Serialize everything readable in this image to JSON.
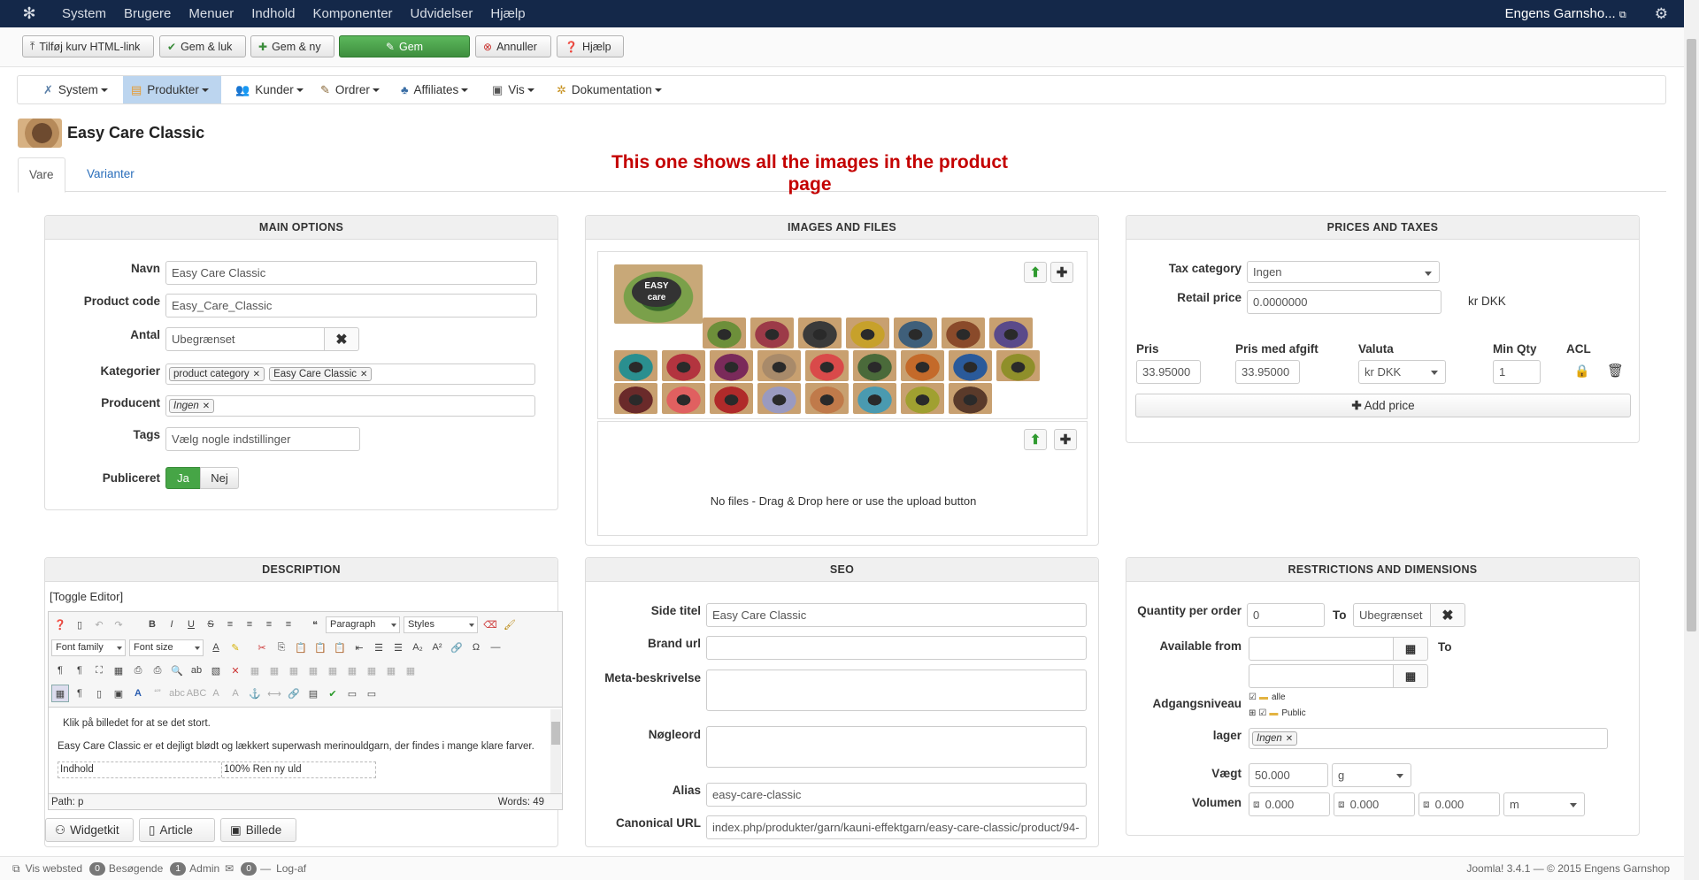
{
  "topnav": {
    "items": [
      "System",
      "Brugere",
      "Menuer",
      "Indhold",
      "Komponenter",
      "Udvidelser",
      "Hjælp"
    ],
    "site_name": "Engens Garnsho..."
  },
  "toolbar": {
    "add_cart_link": "Tilføj kurv HTML-link",
    "save_close": "Gem & luk",
    "save_new": "Gem & ny",
    "save": "Gem",
    "cancel": "Annuller",
    "help": "Hjælp"
  },
  "subnav": {
    "items": [
      "System",
      "Produkter",
      "Kunder",
      "Ordrer",
      "Affiliates",
      "Vis",
      "Dokumentation"
    ]
  },
  "product": {
    "title": "Easy Care Classic"
  },
  "tabs": {
    "item": "Vare",
    "variants": "Varianter"
  },
  "annotation": "This one shows all the images in the product page",
  "main_options": {
    "heading": "MAIN OPTIONS",
    "name_label": "Navn",
    "name_value": "Easy Care Classic",
    "code_label": "Product code",
    "code_value": "Easy_Care_Classic",
    "qty_label": "Antal",
    "qty_value": "Ubegrænset",
    "cat_label": "Kategorier",
    "cat_chip1": "product category",
    "cat_chip2": "Easy Care Classic",
    "prod_label": "Producent",
    "prod_chip": "Ingen",
    "tags_label": "Tags",
    "tags_placeholder": "Vælg nogle indstillinger",
    "pub_label": "Publiceret",
    "pub_yes": "Ja",
    "pub_no": "Nej"
  },
  "images": {
    "heading": "IMAGES AND FILES",
    "no_files": "No files - Drag & Drop here or use the upload button",
    "thumb_badge_line1": "EASY",
    "thumb_badge_line2": "care"
  },
  "prices": {
    "heading": "PRICES AND TAXES",
    "tax_label": "Tax category",
    "tax_value": "Ingen",
    "retail_label": "Retail price",
    "retail_value": "0.0000000",
    "retail_currency": "kr DKK",
    "col_price": "Pris",
    "col_price_tax": "Pris med afgift",
    "col_currency": "Valuta",
    "col_minqty": "Min Qty",
    "col_acl": "ACL",
    "price_value": "33.95000",
    "price_tax_value": "33.95000",
    "currency_value": "kr DKK",
    "minqty_value": "1",
    "add_price": "Add price"
  },
  "description": {
    "heading": "DESCRIPTION",
    "toggle": "[Toggle Editor]",
    "paragraph_sel": "Paragraph",
    "styles_sel": "Styles",
    "font_family_sel": "Font family",
    "font_size_sel": "Font size",
    "line1": "Klik på billedet for at se det stort.",
    "line2": "Easy Care Classic er et dejligt blødt og lækkert superwash merinouldgarn, der findes i mange klare farver.",
    "table_c1": "Indhold",
    "table_c2": "100% Ren ny uld",
    "path": "Path: p",
    "words": "Words: 49",
    "btn_widgetkit": "Widgetkit",
    "btn_article": "Article",
    "btn_image": "Billede"
  },
  "seo": {
    "heading": "SEO",
    "page_title_label": "Side titel",
    "page_title_value": "Easy Care Classic",
    "brand_url_label": "Brand url",
    "meta_label": "Meta-beskrivelse",
    "keywords_label": "Nøgleord",
    "alias_label": "Alias",
    "alias_value": "easy-care-classic",
    "canonical_label": "Canonical URL",
    "canonical_value": "index.php/produkter/garn/kauni-effektgarn/easy-care-classic/product/94-"
  },
  "restrictions": {
    "heading": "RESTRICTIONS AND DIMENSIONS",
    "qpo_label": "Quantity per order",
    "qpo_from": "0",
    "qpo_to_label": "To",
    "qpo_to": "Ubegrænset",
    "avail_label": "Available from",
    "avail_to_label": "To",
    "access_label": "Adgangsniveau",
    "access_all": "alle",
    "access_public": "Public",
    "stock_label": "lager",
    "stock_chip": "Ingen",
    "weight_label": "Vægt",
    "weight_value": "50.000",
    "weight_unit": "g",
    "volume_label": "Volumen",
    "vol1": "0.000",
    "vol2": "0.000",
    "vol3": "0.000",
    "vol_unit": "m"
  },
  "footer": {
    "view_site": "Vis websted",
    "visitors_count": "0",
    "visitors_label": "Besøgende",
    "admin_count": "1",
    "admin_label": "Admin",
    "msg_count": "0",
    "logout": "Log-af",
    "version": "Joomla! 3.4.1 — © 2015 Engens Garnshop"
  }
}
